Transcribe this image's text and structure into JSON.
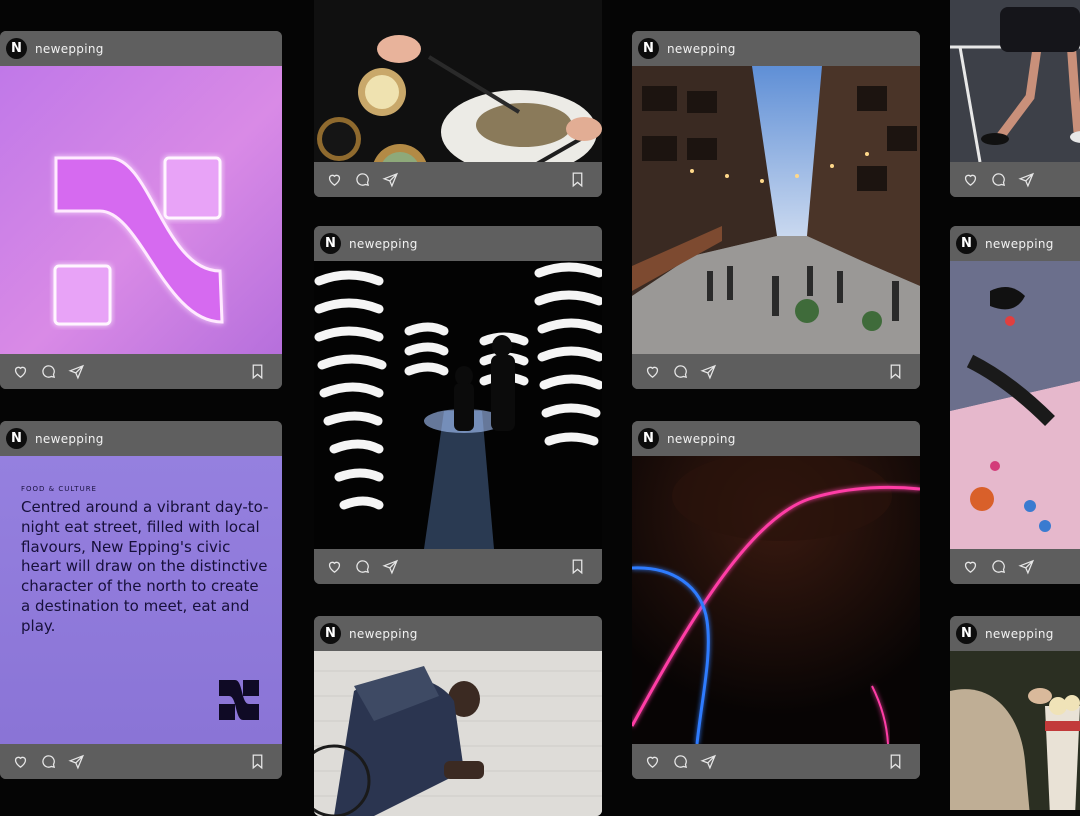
{
  "account": {
    "name": "newepping",
    "logo_glyph": "N"
  },
  "icons": [
    "heart-icon",
    "comment-icon",
    "share-icon",
    "bookmark-icon"
  ],
  "colors": {
    "background": "#050505",
    "card_bar": "#5e5e5e",
    "text_card_bg": "#8a74d6",
    "neon_pink": "#ff3da6",
    "neon_blue": "#2f7bff"
  },
  "text_card": {
    "label": "FOOD & CULTURE",
    "body": "Centred around a vibrant day-to-night eat street, filled with local flavours, New Epping's civic heart will draw on the distinctive character of the north to create a destination to meet, eat and play.",
    "mark": "N"
  }
}
